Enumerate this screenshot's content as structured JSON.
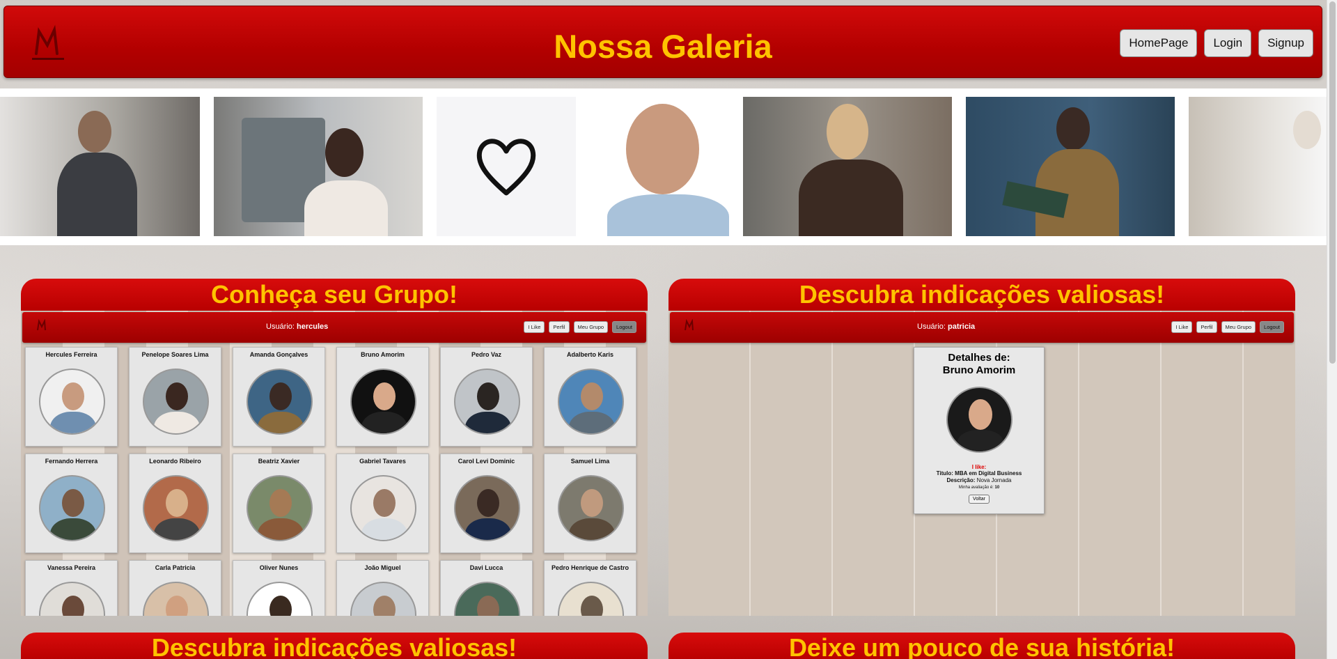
{
  "header": {
    "title": "Nossa Galeria",
    "nav": [
      "HomePage",
      "Login",
      "Signup"
    ]
  },
  "panels": {
    "group": {
      "title": "Conheça seu Grupo!",
      "user_label": "Usuário:",
      "user_name": "hercules",
      "nav": [
        "I Like",
        "Perfil",
        "Meu Grupo",
        "Logout"
      ],
      "members": [
        "Hercules Ferreira",
        "Penelope Soares Lima",
        "Amanda Gonçalves",
        "Bruno Amorim",
        "Pedro Vaz",
        "Adalberto Karis",
        "Fernando Herrera",
        "Leonardo Ribeiro",
        "Beatriz Xavier",
        "Gabriel Tavares",
        "Carol Levi Dominic",
        "Samuel Lima",
        "Vanessa Pereira",
        "Carla Patricia",
        "Oliver Nunes",
        "João Miguel",
        "Davi Lucca",
        "Pedro Henrique de Castro"
      ]
    },
    "recommend": {
      "title": "Descubra indicações valiosas!",
      "user_label": "Usuário:",
      "user_name": "patricia",
      "nav": [
        "I Like",
        "Perfil",
        "Meu Grupo",
        "Logout"
      ],
      "details": {
        "heading_line1": "Detalhes de:",
        "heading_line2": "Bruno Amorim",
        "like_label": "I like:",
        "title_label": "Titulo:",
        "title_value": "MBA em Digital Business",
        "desc_label": "Descrição:",
        "desc_value": "Nova Jornada",
        "rating_label": "Minha avaliação é:",
        "rating_value": "10",
        "back_label": "Voltar"
      }
    }
  },
  "bottom": {
    "left_title": "Descubra indicações valiosas!",
    "right_title": "Deixe um pouco de sua história!"
  },
  "colors": {
    "brand_red": "#c40808",
    "title_yellow": "#ffc300"
  }
}
